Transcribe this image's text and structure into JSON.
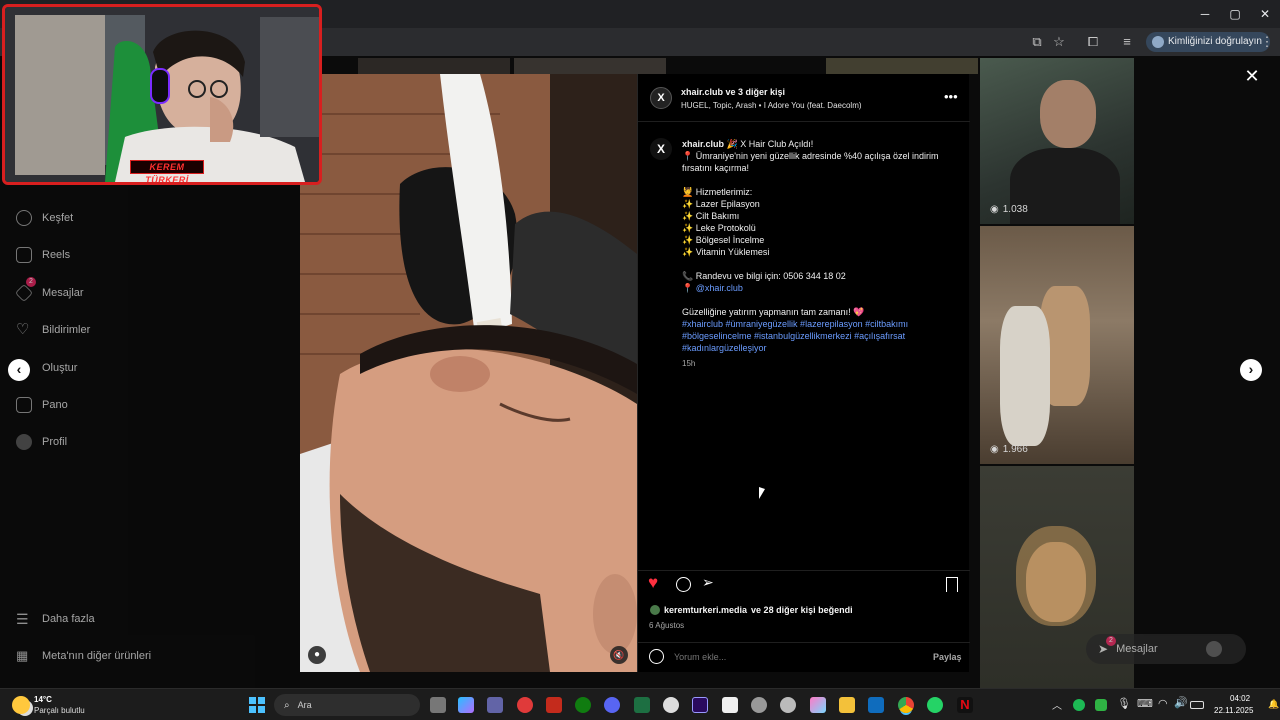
{
  "browser": {
    "verify_label": "Kimliğinizi doğrulayın"
  },
  "webcam": {
    "name_tag": "KEREM TÜRKERİ"
  },
  "sidebar": {
    "items": [
      {
        "label": "Keşfet",
        "icon": "compass-icon"
      },
      {
        "label": "Reels",
        "icon": "reels-icon"
      },
      {
        "label": "Mesajlar",
        "icon": "messenger-icon",
        "badge": "2"
      },
      {
        "label": "Bildirimler",
        "icon": "heart-icon"
      },
      {
        "label": "Oluştur",
        "icon": "plus-square-icon"
      },
      {
        "label": "Pano",
        "icon": "dashboard-icon"
      },
      {
        "label": "Profil",
        "icon": "profile-avatar-icon"
      }
    ],
    "more_label": "Daha fazla",
    "meta_label": "Meta'nın diğer ürünleri"
  },
  "grid": {
    "views": [
      "1.038",
      "1.966"
    ]
  },
  "post": {
    "header_title": "xhair.club ve 3 diğer kişi",
    "header_audio": "HUGEL, Topic, Arash • I Adore You (feat. Daecolm)",
    "caption_user": "xhair.club",
    "caption_lines": [
      "🎉 X Hair Club Açıldı!",
      "📍 Ümraniye'nin yeni güzellik adresinde %40 açılışa özel indirim fırsatını kaçırma!",
      "",
      "💆 Hizmetlerimiz:",
      "✨ Lazer Epilasyon",
      "✨ Cilt Bakımı",
      "✨ Leke Protokolü",
      "✨ Bölgesel İncelme",
      "✨ Vitamin Yüklemesi",
      "",
      "📞 Randevu ve bilgi için: 0506 344 18 02",
      "📍 @xhair.club",
      "",
      "Güzelliğine yatırım yapmanın tam zamanı! 💖"
    ],
    "mention": "@xhair.club",
    "hashtags": "#xhairclub #ümraniyegüzellik #lazerepilasyon #ciltbakımı #bölgeselincelme #istanbulgüzellikmerkezi #açılışafırsat #kadınlargüzelleşiyor",
    "time_ago": "15h",
    "liked_by_user": "keremturkeri.media",
    "liked_by_rest": "ve 28 diğer kişi beğendi",
    "date": "6 Ağustos",
    "comment_placeholder": "Yorum ekle...",
    "share_label": "Paylaş"
  },
  "messages_float": {
    "label": "Mesajlar",
    "badge": "2"
  },
  "taskbar": {
    "weather_temp": "14°C",
    "weather_desc": "Parçalı bulutlu",
    "search_placeholder": "Ara",
    "time": "04:02",
    "date": "22.11.2025"
  },
  "colors": {
    "like": "#ff3040",
    "link": "#6b9cff",
    "webcam_frame": "#d81f1f"
  }
}
